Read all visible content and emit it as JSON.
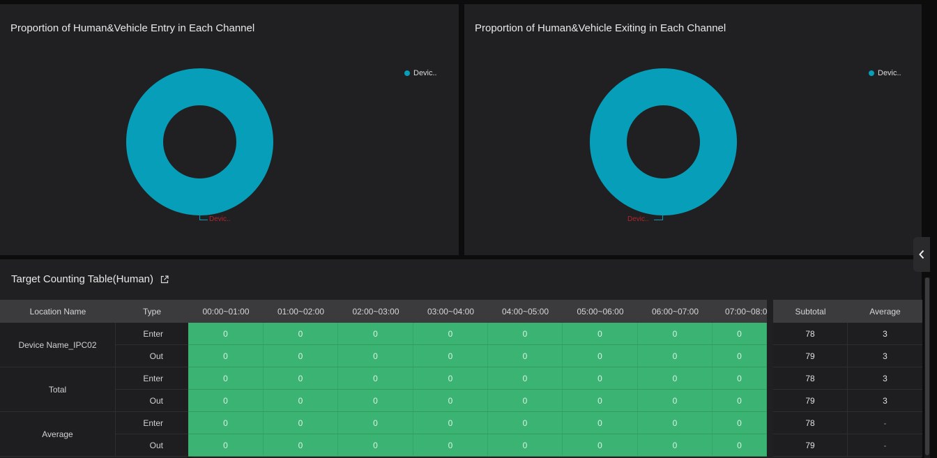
{
  "charts": [
    {
      "title": "Proportion of Human&Vehicle Entry in Each Channel",
      "legend_label": "Devic..",
      "slice_label": "Devic..",
      "color": "#069eb8"
    },
    {
      "title": "Proportion of Human&Vehicle Exiting in Each Channel",
      "legend_label": "Devic..",
      "slice_label": "Devic..",
      "color": "#069eb8"
    }
  ],
  "chart_data": [
    {
      "type": "pie",
      "title": "Proportion of Human&Vehicle Entry in Each Channel",
      "labels": [
        "Devic.."
      ],
      "values": [
        100
      ],
      "colors": [
        "#069eb8"
      ],
      "legend": "top-right"
    },
    {
      "type": "pie",
      "title": "Proportion of Human&Vehicle Exiting in Each Channel",
      "labels": [
        "Devic.."
      ],
      "values": [
        100
      ],
      "colors": [
        "#069eb8"
      ],
      "legend": "top-right"
    }
  ],
  "table": {
    "title": "Target Counting Table(Human)",
    "icon": "external-link-icon",
    "headers": {
      "location": "Location Name",
      "type": "Type",
      "hours": [
        "00:00~01:00",
        "01:00~02:00",
        "02:00~03:00",
        "03:00~04:00",
        "04:00~05:00",
        "05:00~06:00",
        "06:00~07:00",
        "07:00~08:0"
      ],
      "subtotal": "Subtotal",
      "average": "Average"
    },
    "groups": [
      {
        "location": "Device Name_IPC02",
        "rows": [
          {
            "type": "Enter",
            "hours": [
              "0",
              "0",
              "0",
              "0",
              "0",
              "0",
              "0",
              "0"
            ],
            "subtotal": "78",
            "average": "3"
          },
          {
            "type": "Out",
            "hours": [
              "0",
              "0",
              "0",
              "0",
              "0",
              "0",
              "0",
              "0"
            ],
            "subtotal": "79",
            "average": "3"
          }
        ]
      },
      {
        "location": "Total",
        "rows": [
          {
            "type": "Enter",
            "hours": [
              "0",
              "0",
              "0",
              "0",
              "0",
              "0",
              "0",
              "0"
            ],
            "subtotal": "78",
            "average": "3"
          },
          {
            "type": "Out",
            "hours": [
              "0",
              "0",
              "0",
              "0",
              "0",
              "0",
              "0",
              "0"
            ],
            "subtotal": "79",
            "average": "3"
          }
        ]
      },
      {
        "location": "Average",
        "rows": [
          {
            "type": "Enter",
            "hours": [
              "0",
              "0",
              "0",
              "0",
              "0",
              "0",
              "0",
              "0"
            ],
            "subtotal": "78",
            "average": "-"
          },
          {
            "type": "Out",
            "hours": [
              "0",
              "0",
              "0",
              "0",
              "0",
              "0",
              "0",
              "0"
            ],
            "subtotal": "79",
            "average": "-"
          }
        ]
      }
    ],
    "colors": {
      "cell_green": "#3bb372",
      "header_bg": "#3b3b3e",
      "slice_label": "#b3252d"
    }
  },
  "sidebar_toggle": {
    "icon": "chevron-left-icon"
  }
}
